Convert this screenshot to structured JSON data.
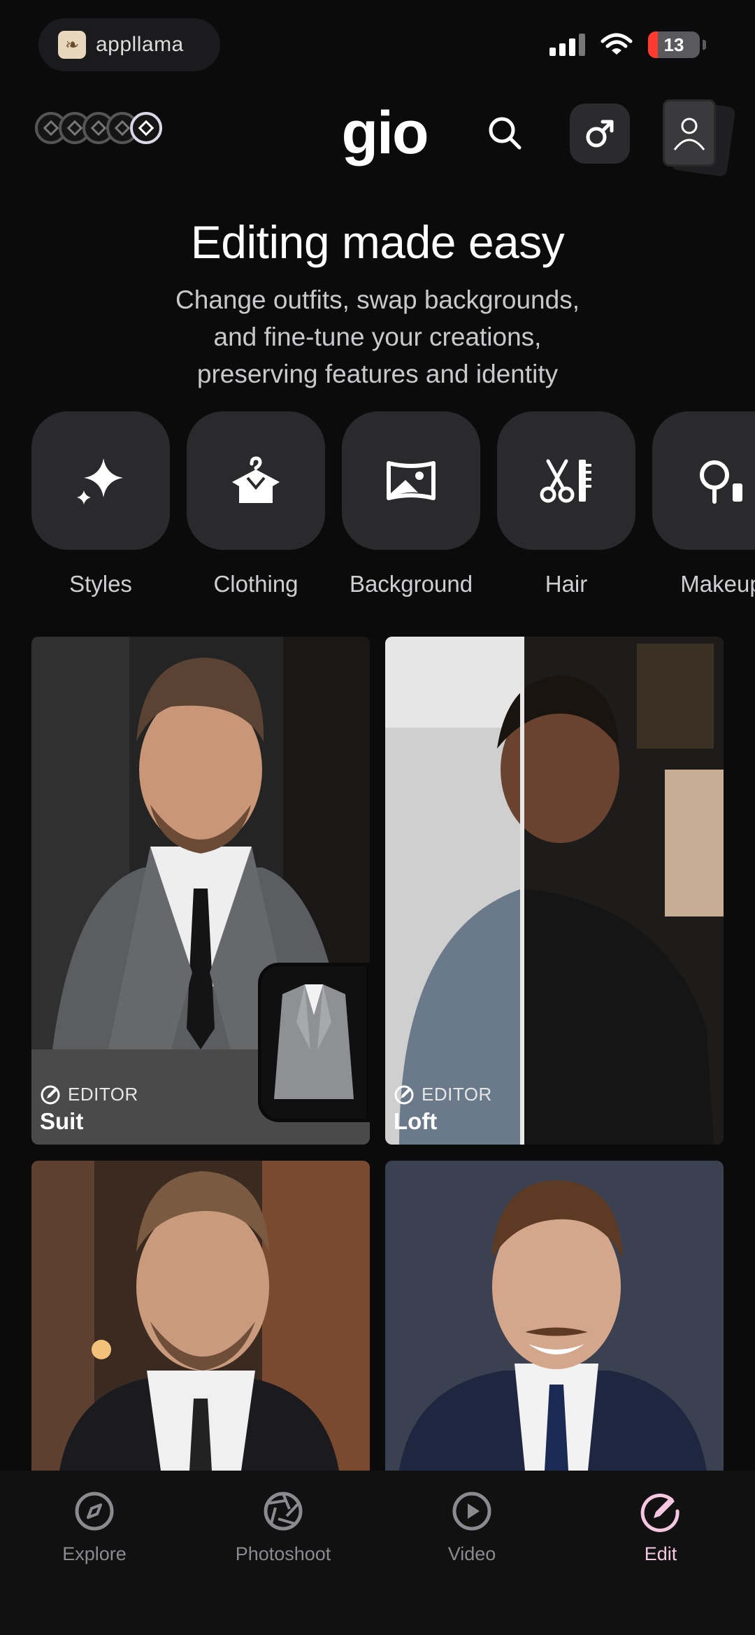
{
  "status_bar": {
    "app_badge": "appllama",
    "battery_level": "13",
    "signal_bars": 4,
    "wifi_icon": "wifi-icon"
  },
  "header": {
    "brand": "gio",
    "credits_count_icons": 5,
    "search_icon": "search-icon",
    "gender_icon": "male-symbol-icon",
    "profile_icon": "profile-avatar-icon"
  },
  "hero": {
    "title": "Editing made easy",
    "subtitle_lines": [
      "Change outfits, swap backgrounds,",
      "and fine-tune your creations,",
      "preserving features and identity"
    ]
  },
  "categories": [
    {
      "label": "Styles",
      "icon": "sparkles-icon"
    },
    {
      "label": "Clothing",
      "icon": "hanger-shirt-icon"
    },
    {
      "label": "Background",
      "icon": "landscape-image-icon"
    },
    {
      "label": "Hair",
      "icon": "scissors-comb-icon"
    },
    {
      "label": "Makeup",
      "icon": "makeup-icon"
    }
  ],
  "cards": [
    {
      "badge": "EDITOR",
      "title": "Suit"
    },
    {
      "badge": "EDITOR",
      "title": "Loft"
    },
    {
      "badge": "",
      "title": ""
    },
    {
      "badge": "",
      "title": ""
    }
  ],
  "bottom_nav": [
    {
      "label": "Explore",
      "icon": "compass-icon",
      "active": false
    },
    {
      "label": "Photoshoot",
      "icon": "aperture-icon",
      "active": false
    },
    {
      "label": "Video",
      "icon": "play-circle-icon",
      "active": false
    },
    {
      "label": "Edit",
      "icon": "edit-pencil-icon",
      "active": true
    }
  ],
  "colors": {
    "background": "#0b0b0c",
    "tile": "#2a2a2c",
    "active_nav": "#f4c6df",
    "battery_low": "#ff3b30"
  }
}
